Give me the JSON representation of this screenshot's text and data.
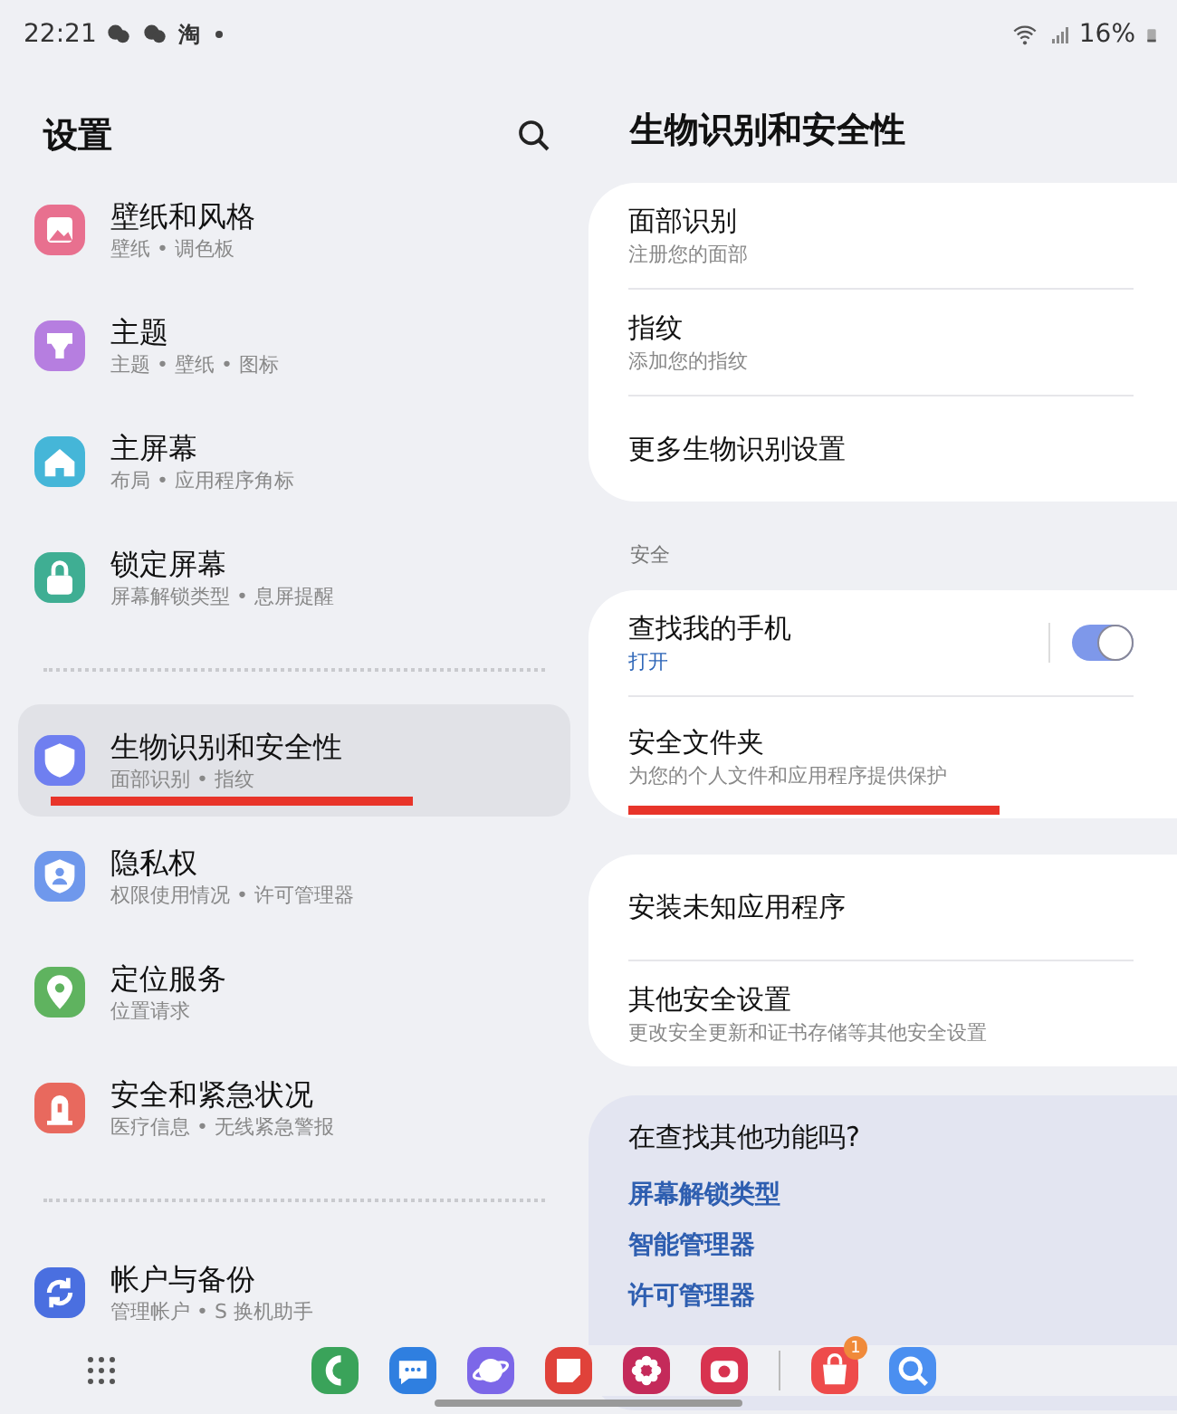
{
  "status_bar": {
    "time": "22:21",
    "app_glyph": "淘",
    "battery": "16%"
  },
  "left": {
    "title": "设置",
    "groups": [
      [
        {
          "title": "壁纸和风格",
          "subtitle": "壁纸 • 调色板",
          "color": "#e8708f",
          "selected": false,
          "underlined": false
        },
        {
          "title": "主题",
          "subtitle": "主题 • 壁纸 • 图标",
          "color": "#b67ee0",
          "selected": false,
          "underlined": false
        },
        {
          "title": "主屏幕",
          "subtitle": "布局 • 应用程序角标",
          "color": "#45b6d8",
          "selected": false,
          "underlined": false
        },
        {
          "title": "锁定屏幕",
          "subtitle": "屏幕解锁类型 • 息屏提醒",
          "color": "#3fae93",
          "selected": false,
          "underlined": false
        }
      ],
      [
        {
          "title": "生物识别和安全性",
          "subtitle": "面部识别 • 指纹",
          "color": "#6f7ff0",
          "selected": true,
          "underlined": true
        },
        {
          "title": "隐私权",
          "subtitle": "权限使用情况 • 许可管理器",
          "color": "#6f98ec",
          "selected": false,
          "underlined": false
        },
        {
          "title": "定位服务",
          "subtitle": "位置请求",
          "color": "#5fb35f",
          "selected": false,
          "underlined": false
        },
        {
          "title": "安全和紧急状况",
          "subtitle": "医疗信息 • 无线紧急警报",
          "color": "#e8695e",
          "selected": false,
          "underlined": false
        }
      ],
      [
        {
          "title": "帐户与备份",
          "subtitle": "管理帐户 • S 换机助手",
          "color": "#4a6fe0",
          "selected": false,
          "underlined": false
        }
      ]
    ]
  },
  "right": {
    "title": "生物识别和安全性",
    "sections": [
      {
        "kind": "card",
        "items": [
          {
            "title": "面部识别",
            "subtitle": "注册您的面部",
            "underlined": false
          },
          {
            "title": "指纹",
            "subtitle": "添加您的指纹",
            "underlined": false
          },
          {
            "title": "更多生物识别设置",
            "underlined": false
          }
        ]
      },
      {
        "kind": "card",
        "label": "安全",
        "items": [
          {
            "title": "查找我的手机",
            "subtitle": "打开",
            "toggle": {
              "on": true
            },
            "underlined": false
          },
          {
            "title": "安全文件夹",
            "subtitle": "为您的个人文件和应用程序提供保护",
            "underlined": true
          }
        ]
      },
      {
        "kind": "card",
        "items": [
          {
            "title": "安装未知应用程序",
            "underlined": false
          },
          {
            "title": "其他安全设置",
            "subtitle": "更改安全更新和证书存储等其他安全设置",
            "underlined": false
          }
        ]
      },
      {
        "kind": "suggestions",
        "heading": "在查找其他功能吗?",
        "links": [
          "屏幕解锁类型",
          "智能管理器",
          "许可管理器"
        ]
      }
    ]
  },
  "dock": {
    "apps": [
      {
        "color": "#3aa35a"
      },
      {
        "color": "#2f7fe0"
      },
      {
        "color": "#7c67e8"
      },
      {
        "color": "#e0423a"
      },
      {
        "color": "#c42a5a"
      },
      {
        "color": "#d8334f"
      },
      {
        "color": "#ee4b4b",
        "badge": "1"
      },
      {
        "color": "#4b8ff0"
      }
    ]
  }
}
